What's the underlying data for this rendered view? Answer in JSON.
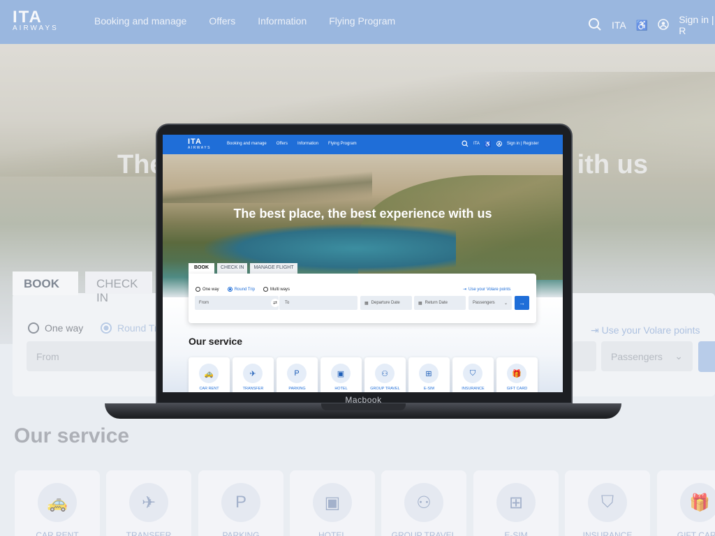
{
  "background": {
    "logo_line1": "ITA",
    "logo_line2": "AIRWAYS",
    "nav": [
      "Booking and manage",
      "Offers",
      "Information",
      "Flying Program"
    ],
    "lang": "ITA",
    "sign_in": "Sign in | R",
    "hero_left": "The",
    "hero_right": "ith us",
    "tabs": [
      "BOOK",
      "CHECK IN"
    ],
    "trip_one_way": "One way",
    "trip_round": "Round Trip",
    "from_placeholder": "From",
    "volare": "Use your Volare points",
    "passengers": "Passengers",
    "service_title": "Our service",
    "cards": [
      "CAR RENT",
      "TRANSFER",
      "PARKING",
      "HOTEL",
      "GROUP TRAVEL",
      "E-SIM",
      "INSURANCE",
      "GIFT CARD"
    ]
  },
  "laptop": {
    "label": "Macbook"
  },
  "screen": {
    "logo_line1": "ITA",
    "logo_line2": "AIRWAYS",
    "nav": [
      "Booking and manage",
      "Offers",
      "Information",
      "Flying Program"
    ],
    "lang": "ITA",
    "sign_in": "Sign in | Register",
    "hero_title": "The best place, the best experience with us",
    "tabs": [
      "BOOK",
      "CHECK IN",
      "MANAGE FLIGHT"
    ],
    "trip_types": [
      "One way",
      "Round Trip",
      "Multi ways"
    ],
    "volare": "Use your Volare points",
    "from": "From",
    "to": "To",
    "departure": "Departure Date",
    "return": "Return Date",
    "passengers": "Passengers",
    "service_title": "Our service",
    "services": [
      {
        "label": "CAR RENT",
        "icon": "car-icon"
      },
      {
        "label": "TRANSFER",
        "icon": "plane-icon"
      },
      {
        "label": "PARKING",
        "icon": "parking-icon"
      },
      {
        "label": "HOTEL",
        "icon": "hotel-icon"
      },
      {
        "label": "GROUP TRAVEL",
        "icon": "group-icon"
      },
      {
        "label": "E-SIM",
        "icon": "sim-icon"
      },
      {
        "label": "INSURANCE",
        "icon": "shield-icon"
      },
      {
        "label": "GIFT CARD",
        "icon": "gift-icon"
      }
    ]
  },
  "colors": {
    "brand_blue": "#1f6ed8",
    "bg_nav": "#6f9ad4"
  }
}
